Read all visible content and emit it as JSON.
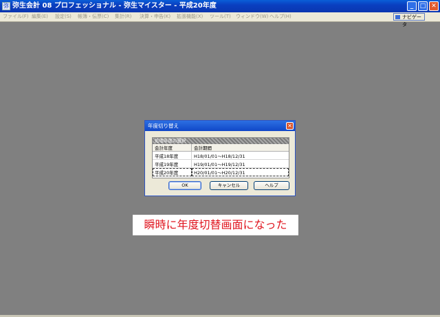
{
  "window": {
    "app_icon_glyph": "弥",
    "title": "弥生会計 08 プロフェッショナル - 弥生マイスター - 平成20年度",
    "minimize_glyph": "_",
    "maximize_glyph": "□",
    "close_glyph": "✕"
  },
  "menu": {
    "items": [
      "ファイル(F)",
      "編集(E)",
      "設定(S)",
      "帳簿・伝票(C)",
      "集計(R)",
      "決算・申告(K)",
      "拡張機能(X)",
      "ツール(T)",
      "ウィンドウ(W)",
      "ヘルプ(H)"
    ],
    "navigator_label": "ナビゲータ"
  },
  "dialog": {
    "title": "年度切り替え",
    "close_glyph": "✕",
    "group_title": "処理年度の選択",
    "columns": [
      "会計年度",
      "会計期間"
    ],
    "rows": [
      {
        "year": "平成18年度",
        "period": "H18/01/01～H18/12/31"
      },
      {
        "year": "平成19年度",
        "period": "H19/01/01～H19/12/31"
      },
      {
        "year": "平成20年度",
        "period": "H20/01/01～H20/12/31"
      }
    ],
    "selected_row": 3,
    "buttons": {
      "ok": "OK",
      "cancel": "キャンセル",
      "help": "ヘルプ"
    }
  },
  "caption": "瞬時に年度切替画面になった",
  "colors": {
    "caption_text": "#e0141e",
    "desktop": "#808080",
    "titlebar": "#0a3fc0"
  }
}
